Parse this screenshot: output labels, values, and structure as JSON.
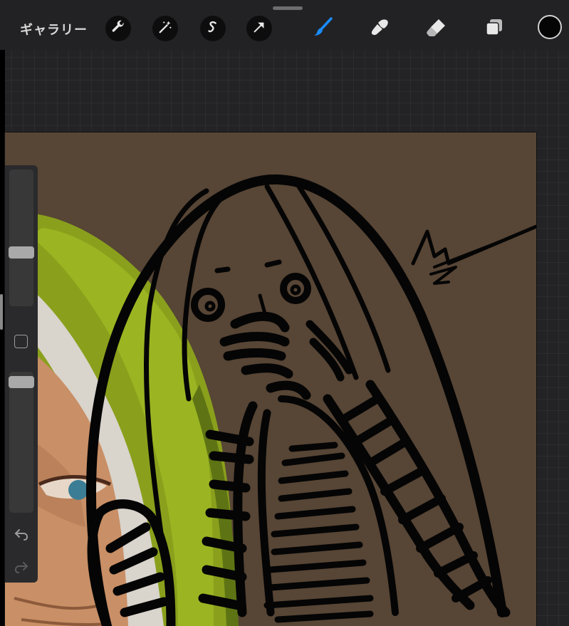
{
  "toolbar": {
    "gallery_label": "ギャラリー",
    "tools": [
      {
        "name": "wrench-icon",
        "role": "actions"
      },
      {
        "name": "magic-wand-icon",
        "role": "adjustments"
      },
      {
        "name": "selection-icon",
        "role": "selection"
      },
      {
        "name": "transform-arrow-icon",
        "role": "transform"
      },
      {
        "name": "brush-icon",
        "role": "paint",
        "active": true
      },
      {
        "name": "smudge-icon",
        "role": "smudge"
      },
      {
        "name": "eraser-icon",
        "role": "erase"
      },
      {
        "name": "layers-icon",
        "role": "layers"
      }
    ],
    "active_color": "#050505",
    "active_tool_color": "#1a8cff"
  },
  "sidebar": {
    "brush_size_level": 0.41,
    "opacity_level": 0.96,
    "undo_icon": "undo-icon",
    "redo_icon": "redo-icon",
    "modify_icon": "modify-square-icon"
  },
  "canvas": {
    "background_color": "#574535",
    "stroke_color": "#050505"
  }
}
